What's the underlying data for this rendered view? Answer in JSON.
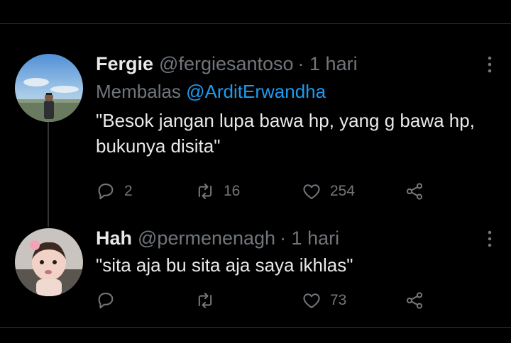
{
  "tweets": [
    {
      "name": "Fergie",
      "handle": "@fergiesantoso",
      "time": "· 1 hari",
      "reply_prefix": "Membalas ",
      "reply_to": "@ArditErwandha",
      "text": "\"Besok jangan lupa bawa hp, yang g bawa hp, bukunya disita\"",
      "replies": "2",
      "retweets": "16",
      "likes": "254"
    },
    {
      "name": "Hah",
      "handle": "@permenenagh",
      "time": "· 1 hari",
      "text": "\"sita aja bu sita aja saya ikhlas\"",
      "likes": "73"
    }
  ],
  "icons": {
    "reply": "reply-icon",
    "retweet": "retweet-icon",
    "like": "heart-icon",
    "share": "share-icon",
    "more": "more-vertical-icon"
  },
  "colors": {
    "background": "#000000",
    "text": "#e7e9ea",
    "muted": "#71767b",
    "accent": "#1d9bf0",
    "divider": "#2f3336"
  }
}
